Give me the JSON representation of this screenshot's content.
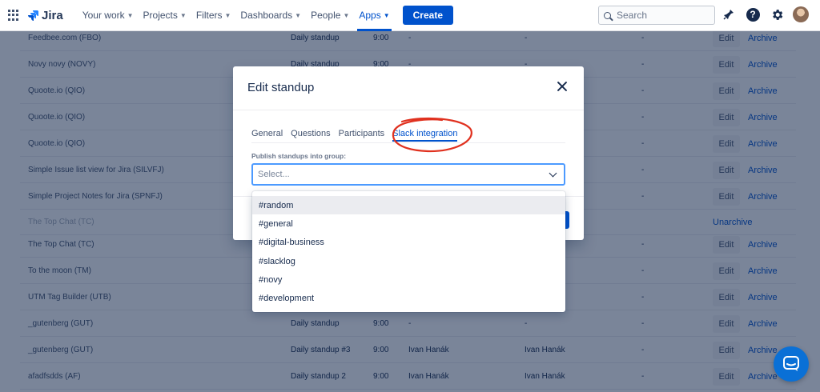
{
  "nav": {
    "brand": "Jira",
    "items": [
      {
        "label": "Your work"
      },
      {
        "label": "Projects"
      },
      {
        "label": "Filters"
      },
      {
        "label": "Dashboards"
      },
      {
        "label": "People"
      },
      {
        "label": "Apps"
      }
    ],
    "create_label": "Create",
    "search_placeholder": "Search"
  },
  "rows": [
    {
      "name": "Feedbee.com (FBO)",
      "type": "Daily standup",
      "time": "9:00",
      "a": "-",
      "b": "-",
      "c": "-",
      "edit": "Edit",
      "action": "Archive"
    },
    {
      "name": "Novy novy (NOVY)",
      "type": "Daily standup",
      "time": "9:00",
      "a": "-",
      "b": "-",
      "c": "-",
      "edit": "Edit",
      "action": "Archive"
    },
    {
      "name": "Quoote.io (QIO)",
      "type": "",
      "time": "",
      "a": "",
      "b": "",
      "c": "-",
      "edit": "Edit",
      "action": "Archive"
    },
    {
      "name": "Quoote.io (QIO)",
      "type": "",
      "time": "",
      "a": "",
      "b": "",
      "c": "-",
      "edit": "Edit",
      "action": "Archive"
    },
    {
      "name": "Quoote.io (QIO)",
      "type": "",
      "time": "",
      "a": "",
      "b": "",
      "c": "-",
      "edit": "Edit",
      "action": "Archive"
    },
    {
      "name": "Simple Issue list view for Jira (SILVFJ)",
      "type": "",
      "time": "",
      "a": "",
      "b": "",
      "c": "-",
      "edit": "Edit",
      "action": "Archive"
    },
    {
      "name": "Simple Project Notes for Jira (SPNFJ)",
      "type": "",
      "time": "",
      "a": "",
      "b": "",
      "c": "-",
      "edit": "Edit",
      "action": "Archive"
    },
    {
      "name": "The Top Chat (TC)",
      "type": "",
      "time": "",
      "a": "",
      "b": "",
      "c": "",
      "edit": "",
      "action": "Unarchive",
      "faded": true
    },
    {
      "name": "The Top Chat (TC)",
      "type": "",
      "time": "",
      "a": "",
      "b": "",
      "c": "-",
      "edit": "Edit",
      "action": "Archive"
    },
    {
      "name": "To the moon (TM)",
      "type": "",
      "time": "",
      "a": "",
      "b": "",
      "c": "-",
      "edit": "Edit",
      "action": "Archive"
    },
    {
      "name": "UTM Tag Builder (UTB)",
      "type": "",
      "time": "",
      "a": "",
      "b": "",
      "c": "-",
      "edit": "Edit",
      "action": "Archive"
    },
    {
      "name": "_gutenberg (GUT)",
      "type": "Daily standup",
      "time": "9:00",
      "a": "-",
      "b": "-",
      "c": "-",
      "edit": "Edit",
      "action": "Archive"
    },
    {
      "name": "_gutenberg (GUT)",
      "type": "Daily standup #3",
      "time": "9:00",
      "a": "Ivan Hanák",
      "b": "Ivan Hanák",
      "c": "-",
      "edit": "Edit",
      "action": "Archive"
    },
    {
      "name": "afadfsdds (AF)",
      "type": "Daily standup 2",
      "time": "9:00",
      "a": "Ivan Hanák",
      "b": "Ivan Hanák",
      "c": "-",
      "edit": "Edit",
      "action": "Archive"
    }
  ],
  "modal": {
    "title": "Edit standup",
    "tabs": [
      {
        "label": "General"
      },
      {
        "label": "Questions"
      },
      {
        "label": "Participants"
      },
      {
        "label": "Slack integration"
      }
    ],
    "active_tab": 3,
    "field_label": "Publish standups into group:",
    "select_placeholder": "Select...",
    "options": [
      "#random",
      "#general",
      "#digital-business",
      "#slacklog",
      "#novy",
      "#development"
    ],
    "hovered_option": 0
  },
  "colors": {
    "brand": "#0052cc",
    "annotation": "#e0311f",
    "chat": "#0a70d6"
  }
}
